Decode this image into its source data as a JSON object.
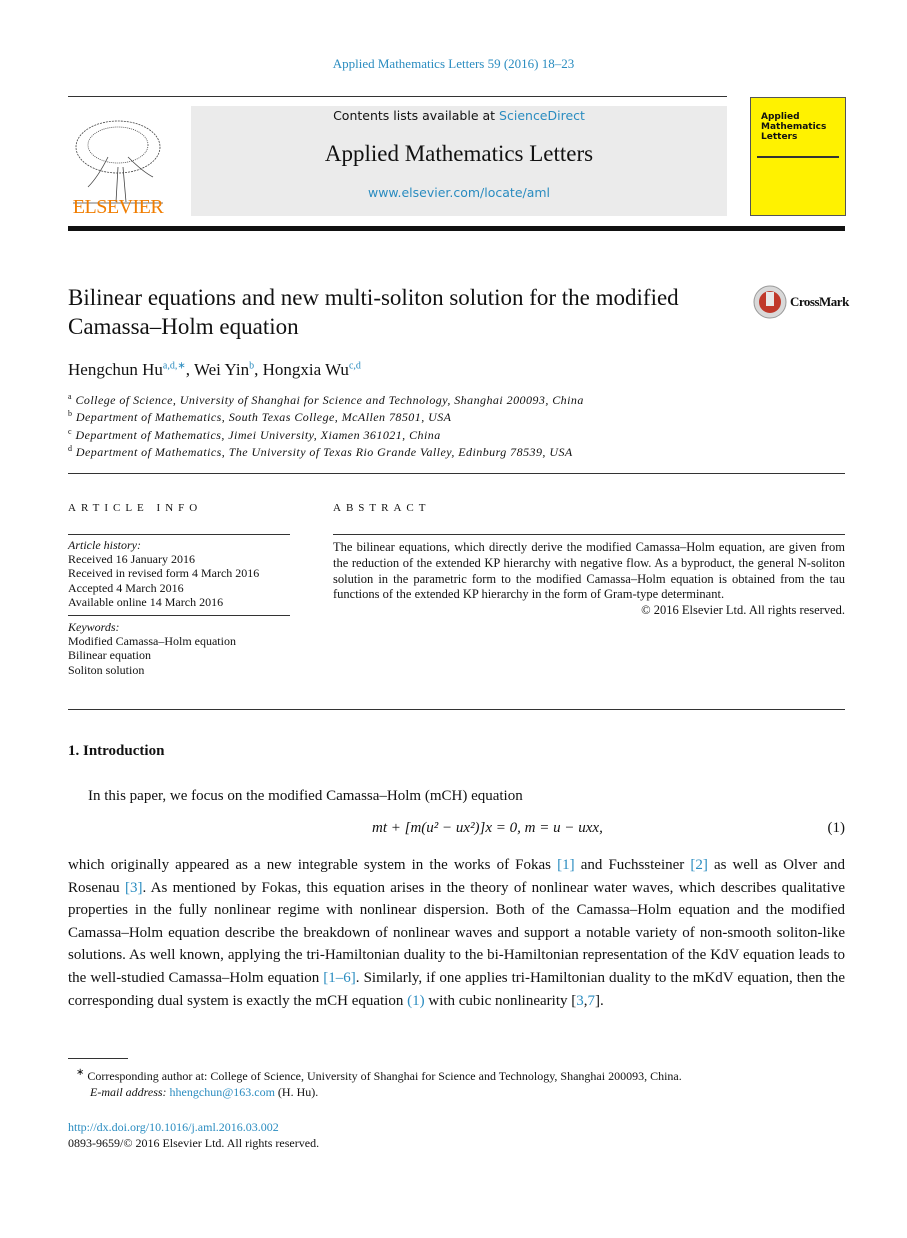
{
  "header": {
    "citation": "Applied Mathematics Letters 59 (2016) 18–23",
    "contents_prefix": "Contents lists available at ",
    "sciencedirect": "ScienceDirect",
    "journal": "Applied Mathematics Letters",
    "url": "www.elsevier.com/locate/aml",
    "publisher": "ELSEVIER",
    "cover_title": "Applied Mathematics Letters",
    "crossmark": "CrossMark",
    "colors": {
      "link": "#2a8cc0",
      "elsevier": "#f07d00",
      "cover": "#fff200"
    }
  },
  "article": {
    "title": "Bilinear equations and new multi-soliton solution for the modified Camassa–Holm equation",
    "authors": [
      {
        "name": "Hengchun Hu",
        "sup": "a,d,∗"
      },
      {
        "name": "Wei Yin",
        "sup": "b"
      },
      {
        "name": "Hongxia Wu",
        "sup": "c,d"
      }
    ],
    "affiliations": [
      {
        "key": "a",
        "text": "College of Science, University of Shanghai for Science and Technology, Shanghai 200093, China"
      },
      {
        "key": "b",
        "text": "Department of Mathematics, South Texas College, McAllen 78501, USA"
      },
      {
        "key": "c",
        "text": "Department of Mathematics, Jimei University, Xiamen 361021, China"
      },
      {
        "key": "d",
        "text": "Department of Mathematics, The University of Texas Rio Grande Valley, Edinburg 78539, USA"
      }
    ]
  },
  "info": {
    "heading": "ARTICLE INFO",
    "history_label": "Article history:",
    "history": [
      "Received 16 January 2016",
      "Received in revised form 4 March 2016",
      "Accepted 4 March 2016",
      "Available online 14 March 2016"
    ],
    "keywords_label": "Keywords:",
    "keywords": [
      "Modified Camassa–Holm equation",
      "Bilinear equation",
      "Soliton solution"
    ]
  },
  "abstract": {
    "heading": "ABSTRACT",
    "text": "The bilinear equations, which directly derive the modified Camassa–Holm equation, are given from the reduction of the extended KP hierarchy with negative flow. As a byproduct, the general N-soliton solution in the parametric form to the modified Camassa–Holm equation is obtained from the tau functions of the extended KP hierarchy in the form of Gram-type determinant.",
    "copyright": "© 2016 Elsevier Ltd. All rights reserved."
  },
  "intro": {
    "heading": "1.  Introduction",
    "p1": "In this paper, we focus on the modified Camassa–Holm (mCH) equation",
    "equation": "mt + [m(u² − ux²)]x = 0,    m = u − uxx,",
    "eq_number": "(1)",
    "p2_parts": [
      "which originally appeared as a new integrable system in the works of Fokas ",
      "[1]",
      " and Fuchssteiner ",
      "[2]",
      " as well as Olver and Rosenau ",
      "[3]",
      ". As mentioned by Fokas, this equation arises in the theory of nonlinear water waves, which describes qualitative properties in the fully nonlinear regime with nonlinear dispersion. Both of the Camassa–Holm equation and the modified Camassa–Holm equation describe the breakdown of nonlinear waves and support a notable variety of non-smooth soliton-like solutions. As well known, applying the tri-Hamiltonian duality to the bi-Hamiltonian representation of the KdV equation leads to the well-studied Camassa–Holm equation ",
      "[1–6]",
      ". Similarly, if one applies tri-Hamiltonian duality to the mKdV equation, then the corresponding dual system is exactly the mCH equation ",
      "(1)",
      " with cubic nonlinearity [",
      "3",
      ",",
      "7",
      "]."
    ]
  },
  "footnote": {
    "mark": "∗",
    "text": "Corresponding author at: College of Science, University of Shanghai for Science and Technology, Shanghai 200093, China.",
    "email_label": "E-mail address: ",
    "email": "hhengchun@163.com",
    "email_suffix": " (H. Hu)."
  },
  "doi": {
    "link": "http://dx.doi.org/10.1016/j.aml.2016.03.002",
    "rights": "0893-9659/© 2016 Elsevier Ltd. All rights reserved."
  }
}
